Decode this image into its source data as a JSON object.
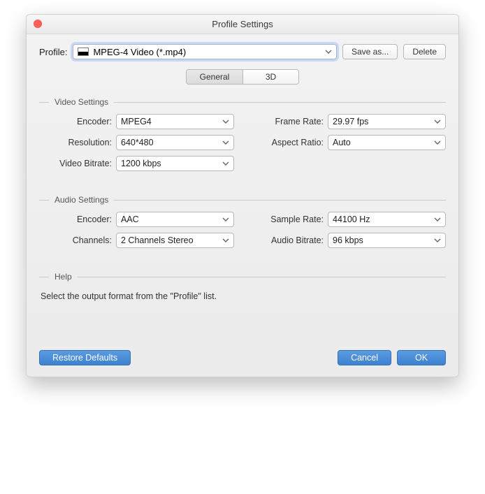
{
  "window": {
    "title": "Profile Settings"
  },
  "profile": {
    "label": "Profile:",
    "selected": "MPEG-4 Video (*.mp4)",
    "save_as": "Save as...",
    "delete": "Delete"
  },
  "tabs": {
    "general": "General",
    "three_d": "3D"
  },
  "video": {
    "title": "Video Settings",
    "encoder_label": "Encoder:",
    "encoder": "MPEG4",
    "resolution_label": "Resolution:",
    "resolution": "640*480",
    "bitrate_label": "Video Bitrate:",
    "bitrate": "1200 kbps",
    "framerate_label": "Frame Rate:",
    "framerate": "29.97 fps",
    "aspect_label": "Aspect Ratio:",
    "aspect": "Auto"
  },
  "audio": {
    "title": "Audio Settings",
    "encoder_label": "Encoder:",
    "encoder": "AAC",
    "channels_label": "Channels:",
    "channels": "2 Channels Stereo",
    "samplerate_label": "Sample Rate:",
    "samplerate": "44100 Hz",
    "bitrate_label": "Audio Bitrate:",
    "bitrate": "96 kbps"
  },
  "help": {
    "title": "Help",
    "text": "Select the output format from the \"Profile\" list."
  },
  "buttons": {
    "restore": "Restore Defaults",
    "cancel": "Cancel",
    "ok": "OK"
  }
}
